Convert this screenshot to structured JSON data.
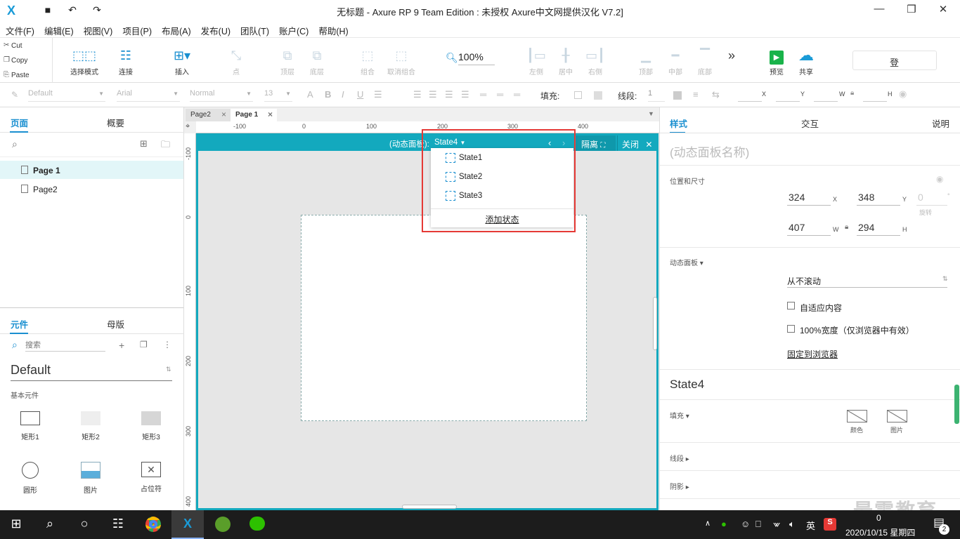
{
  "titlebar": {
    "title": "无标题 - Axure RP 9 Team Edition : 未授权    Axure中文网提供汉化 V7.2]",
    "logo_text": "X"
  },
  "menu": [
    "文件(F)",
    "编辑(E)",
    "视图(V)",
    "项目(P)",
    "布局(A)",
    "发布(U)",
    "团队(T)",
    "账户(C)",
    "帮助(H)"
  ],
  "clipboard": {
    "cut": "Cut",
    "copy": "Copy",
    "paste": "Paste"
  },
  "toolbar": {
    "select_mode": "选择模式",
    "connect": "连接",
    "insert": "插入",
    "point": "点",
    "top": "顶层",
    "bottom": "底层",
    "group": "组合",
    "ungroup": "取消组合",
    "zoom": "100%",
    "align_left": "左侧",
    "align_center": "居中",
    "align_right": "右侧",
    "align_top": "顶部",
    "align_middle": "中部",
    "align_bottom": "底部",
    "more": "»",
    "preview": "预览",
    "share": "共享",
    "login": "登"
  },
  "format": {
    "style": "Default",
    "font": "Arial",
    "weight": "Normal",
    "size": "13",
    "fill_label": "填充:",
    "line_label": "线段:",
    "line_value": "1",
    "x_label": "X",
    "y_label": "Y",
    "w_label": "W",
    "h_label": "H"
  },
  "pages_panel": {
    "tab_pages": "页面",
    "tab_outline": "概要",
    "pages": [
      "Page 1",
      "Page2"
    ]
  },
  "library_panel": {
    "tab_widgets": "元件",
    "tab_masters": "母版",
    "search_placeholder": "搜索",
    "library": "Default",
    "category": "基本元件",
    "widgets": [
      "矩形1",
      "矩形2",
      "矩形3",
      "圆形",
      "图片",
      "占位符"
    ]
  },
  "canvas": {
    "doc_tabs": [
      "Page2",
      "Page 1"
    ],
    "ruler_h": [
      "-100",
      "0",
      "100",
      "200",
      "300",
      "400"
    ],
    "ruler_v": [
      "-100",
      "0",
      "100",
      "200",
      "300",
      "400"
    ],
    "dp_label": "(动态面板):",
    "dp_state": "State4",
    "isolate": "隔离",
    "close": "关闭",
    "states": [
      "State1",
      "State2",
      "State3"
    ],
    "add_state": "添加状态"
  },
  "inspector": {
    "tab_style": "样式",
    "tab_interact": "交互",
    "tab_notes": "说明",
    "name_placeholder": "(动态面板名称)",
    "pos_size_label": "位置和尺寸",
    "x": "324",
    "y": "348",
    "rotation": "0",
    "rotation_label": "旋转",
    "w": "407",
    "h": "294",
    "dp_section": "动态面板",
    "scroll": "从不滚动",
    "fit_content": "自适应内容",
    "full_width": "100%宽度（仅浏览器中有效）",
    "pin": "固定到浏览器",
    "state_name": "State4",
    "fill_label": "填充",
    "fill_color": "颜色",
    "fill_image": "图片",
    "line_label": "线段",
    "shadow_label": "阴影"
  },
  "watermark": "最需教育",
  "taskbar": {
    "ime": "英",
    "datetime": "2020/10/15 星期四",
    "time_partial": "0",
    "notif_count": "2"
  },
  "colors": {
    "accent": "#1a8fd0",
    "panel_teal": "#13a9be",
    "highlight": "#e53935"
  }
}
